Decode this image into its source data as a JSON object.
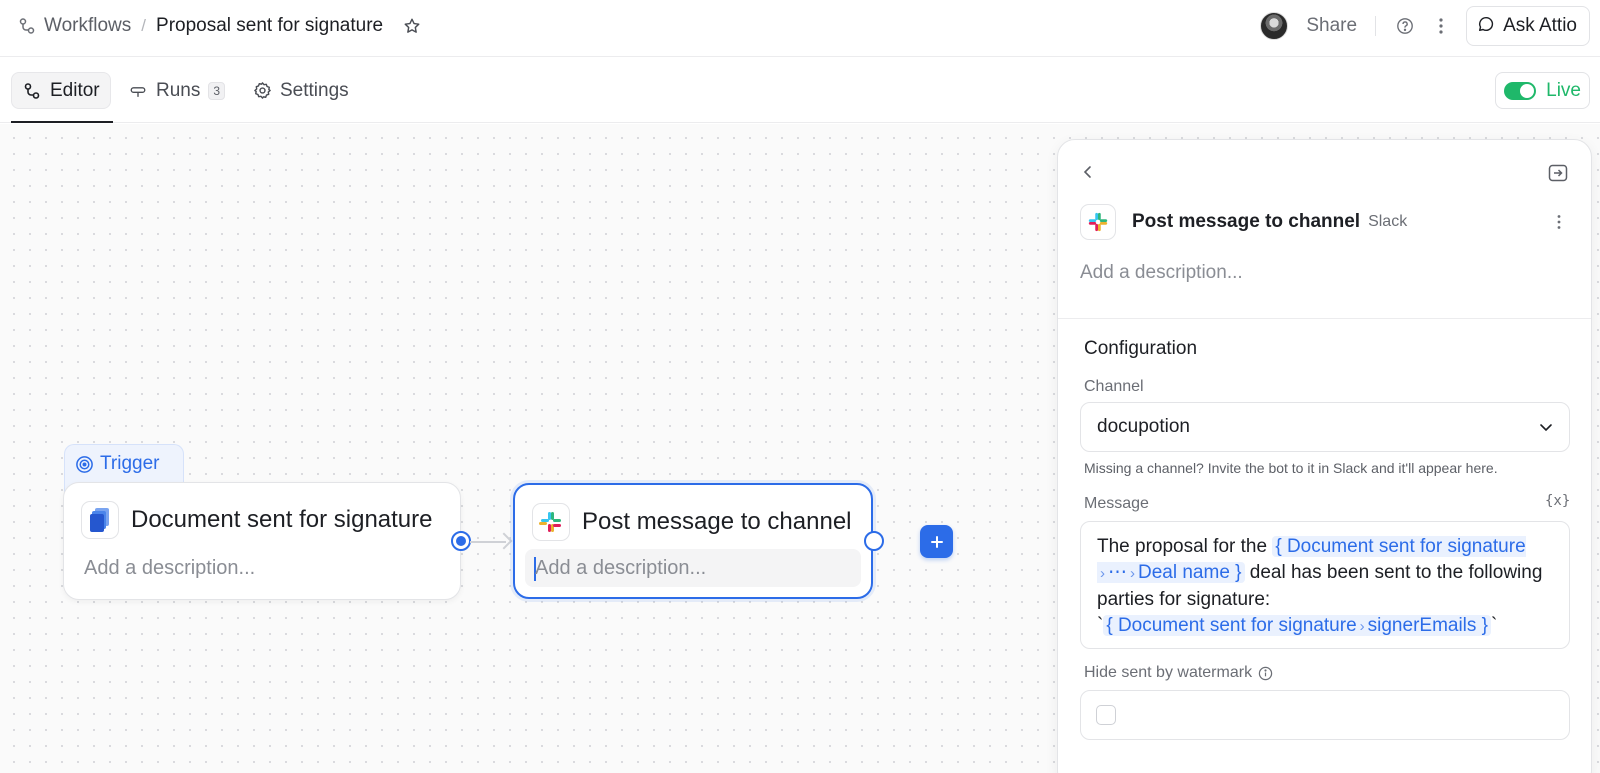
{
  "breadcrumb": {
    "parent": "Workflows",
    "separator": "/",
    "title": "Proposal sent for signature"
  },
  "topbar": {
    "share_label": "Share",
    "ask_label": "Ask Attio"
  },
  "tabs": [
    {
      "label": "Editor",
      "icon": "workflow-icon",
      "active": true
    },
    {
      "label": "Runs",
      "icon": "runs-icon",
      "count": "3"
    },
    {
      "label": "Settings",
      "icon": "gear-icon"
    }
  ],
  "live": {
    "label": "Live",
    "enabled": true,
    "color": "#1fb86a"
  },
  "canvas": {
    "trigger_tag": "Trigger",
    "nodes": [
      {
        "title": "Document sent for signature",
        "description_placeholder": "Add a description...",
        "icon": "document-icon"
      },
      {
        "title": "Post message to channel",
        "description_placeholder": "Add a description...",
        "icon": "slack-icon",
        "selected": true
      }
    ]
  },
  "panel": {
    "title": "Post message to channel",
    "subtitle": "Slack",
    "description_placeholder": "Add a description...",
    "section": "Configuration",
    "channel_label": "Channel",
    "channel_value": "docupotion",
    "channel_help": "Missing a channel? Invite the bot to it in Slack and it'll appear here.",
    "message_label": "Message",
    "variable_button": "{x}",
    "message": {
      "t1": "The proposal for the ",
      "chip1_a": "{ Document sent for signature",
      "chip1_b": "›",
      "chip1_c": "⋯",
      "chip1_d": "›",
      "chip1_e": "Deal name }",
      "t2": " deal has been sent to the following parties for signature:",
      "tick_open": "`",
      "chip2_a": "{ Document sent for signature",
      "chip2_b": "›",
      "chip2_c": "signerEmails }",
      "tick_close": "`"
    },
    "hide_label": "Hide sent by watermark",
    "hide_checked": false
  },
  "colors": {
    "accent": "#2c6ce8",
    "live_green": "#1fb86a"
  }
}
